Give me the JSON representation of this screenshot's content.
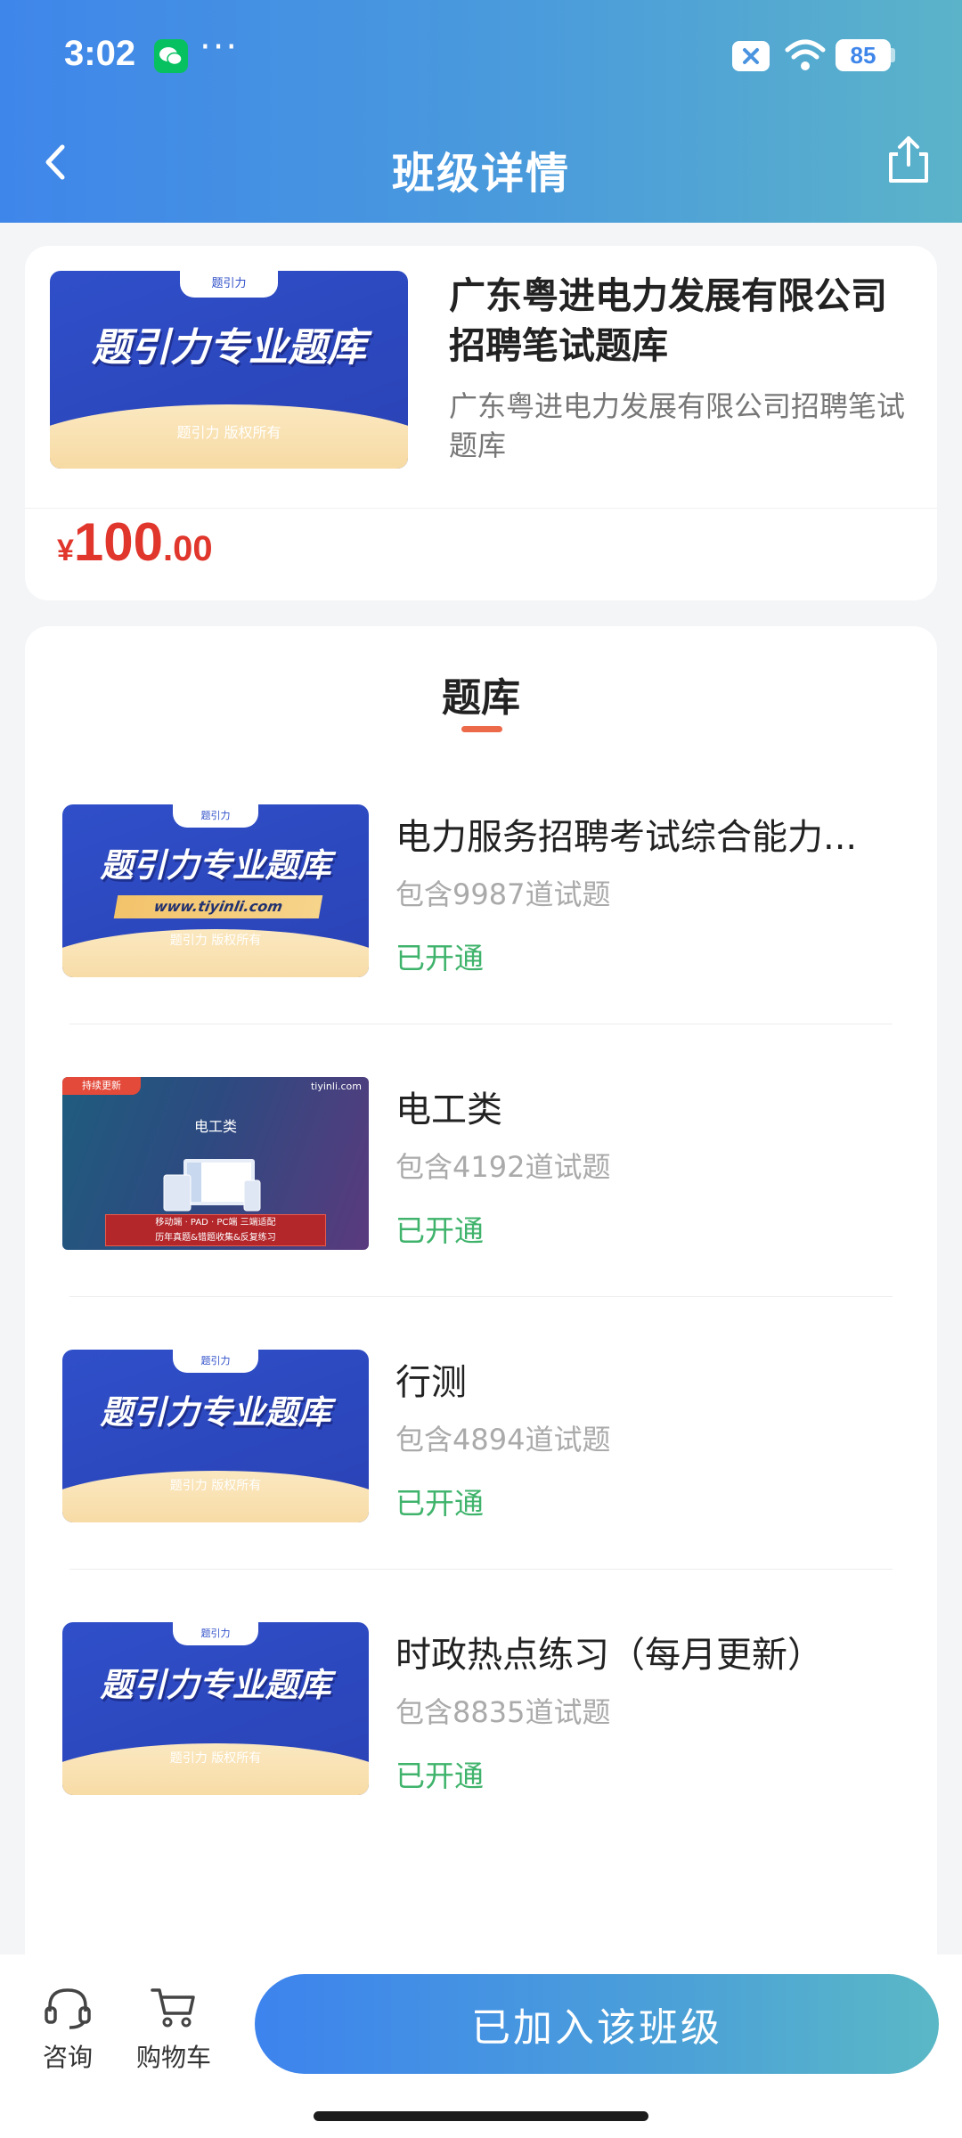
{
  "status_bar": {
    "time": "3:02",
    "dots": "···",
    "battery": "85"
  },
  "nav": {
    "title": "班级详情"
  },
  "product": {
    "name": "广东粤进电力发展有限公司招聘笔试题库",
    "description": "广东粤进电力发展有限公司招聘笔试题库",
    "price_symbol": "¥",
    "price_integer": "100",
    "price_decimal": ".00",
    "banner": {
      "tab_text": "题引力",
      "title": "题引力专业题库",
      "copyright": "题引力 版权所有"
    }
  },
  "bank_section": {
    "title": "题库",
    "items": [
      {
        "name": "电力服务招聘考试综合能力...",
        "count": "包含9987道试题",
        "status": "已开通",
        "thumb": {
          "tab_text": "题引力",
          "title": "题引力专业题库",
          "url": "www.tiyinli.com",
          "copyright": "题引力 版权所有"
        }
      },
      {
        "name": "电工类",
        "count": "包含4192道试题",
        "status": "已开通",
        "thumb": {
          "badge": "持续更新",
          "site": "tiyinli.com",
          "title": "电工类",
          "line1": "移动端 · PAD · PC端 三端适配",
          "line2": "历年真题&错题收集&反复练习"
        }
      },
      {
        "name": "行测",
        "count": "包含4894道试题",
        "status": "已开通",
        "thumb": {
          "tab_text": "题引力",
          "title": "题引力专业题库",
          "copyright": "题引力 版权所有"
        }
      },
      {
        "name": "时政热点练习（每月更新）",
        "count": "包含8835道试题",
        "status": "已开通",
        "thumb": {
          "tab_text": "题引力",
          "title": "题引力专业题库",
          "copyright": "题引力 版权所有"
        }
      }
    ]
  },
  "bottom_bar": {
    "consult_label": "咨询",
    "cart_label": "购物车",
    "join_label": "已加入该班级"
  }
}
